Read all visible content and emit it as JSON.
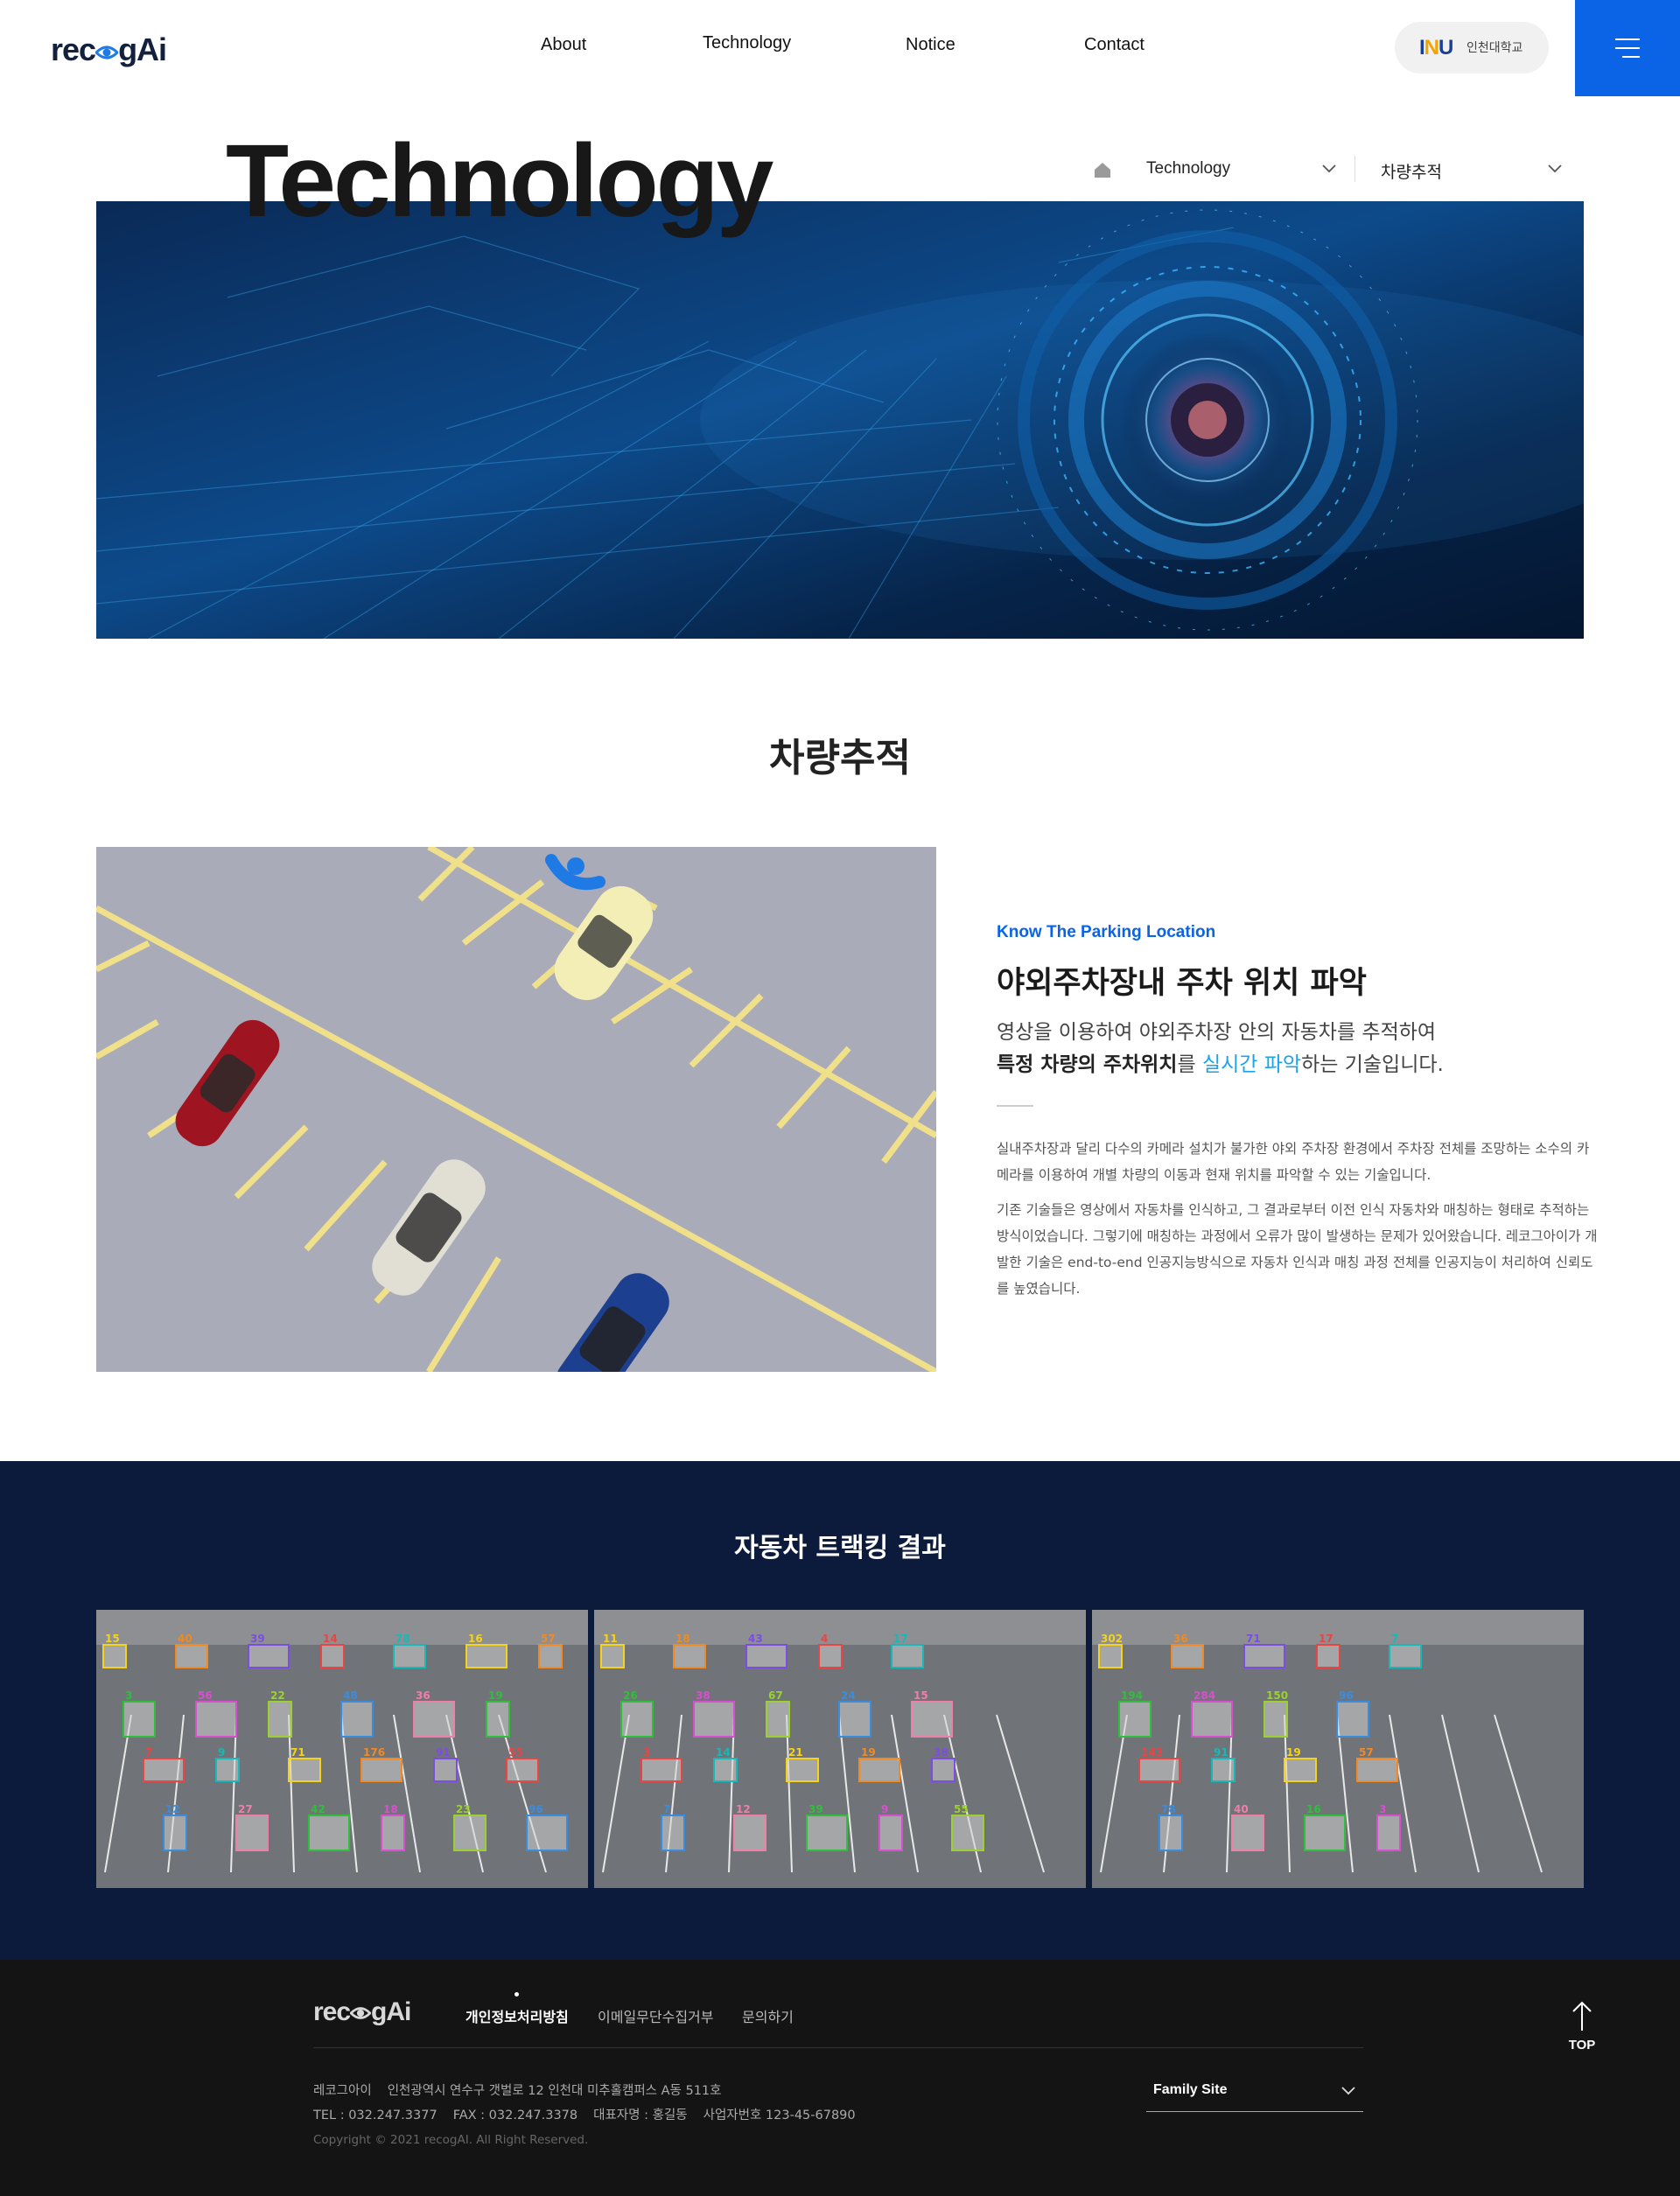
{
  "header": {
    "logo_left": "rec",
    "logo_right": "gAi",
    "nav": [
      {
        "label": "About"
      },
      {
        "label": "Technology"
      },
      {
        "label": "Notice"
      },
      {
        "label": "Contact"
      }
    ],
    "univ_mark_1": "I",
    "univ_mark_2": "N",
    "univ_mark_3": "U",
    "univ_name": "인천대학교",
    "menu_icon": "hamburger-icon",
    "accent": "#0b63e6"
  },
  "hero": {
    "title": "Technology",
    "breadcrumb": {
      "home_icon": "home-icon",
      "level1": "Technology",
      "level2": "차량추적"
    }
  },
  "section": {
    "title": "차량추적",
    "eyebrow": "Know The Parking Location",
    "heading": "야외주차장내 주차 위치 파악",
    "lead_line1": "영상을 이용하여 야외주차장 안의 자동차를 추적하여",
    "lead_bold": "특정 차량의 주차위치",
    "lead_mid": "를 ",
    "lead_highlight": "실시간 파악",
    "lead_end": "하는 기술입니다.",
    "paragraph1": "실내주차장과 달리 다수의 카메라 설치가 불가한 야외 주차장 환경에서 주차장 전체를 조망하는 소수의 카메라를 이용하여 개별 차량의 이동과 현재 위치를 파악할 수 있는 기술입니다.",
    "paragraph2": "기존 기술들은 영상에서 자동차를 인식하고, 그 결과로부터 이전 인식 자동차와 매칭하는 형태로 추적하는 방식이었습니다. 그렇기에 매칭하는 과정에서 오류가 많이 발생하는 문제가 있어왔습니다. 레코그아이가 개발한 기술은 end-to-end 인공지능방식으로 자동차 인식과 매칭 과정 전체를 인공지능이 처리하여 신뢰도를 높였습니다.",
    "highlight_color": "#1aa3e8"
  },
  "results": {
    "title": "자동차 트랙킹 결과",
    "background": "#0c1a3b",
    "frames": [
      {
        "labels": [
          "15",
          "3",
          "7",
          "12",
          "40",
          "56",
          "9",
          "27",
          "39",
          "22",
          "71",
          "42",
          "14",
          "48",
          "176",
          "18",
          "78",
          "36",
          "91",
          "23",
          "16",
          "19",
          "55",
          "96",
          "57"
        ]
      },
      {
        "labels": [
          "11",
          "26",
          "3",
          "7",
          "18",
          "38",
          "14",
          "12",
          "43",
          "67",
          "21",
          "39",
          "4",
          "24",
          "19",
          "9",
          "17",
          "15",
          "38",
          "55"
        ]
      },
      {
        "labels": [
          "302",
          "194",
          "143",
          "78",
          "36",
          "284",
          "91",
          "40",
          "71",
          "150",
          "19",
          "16",
          "17",
          "96",
          "57",
          "3",
          "7"
        ]
      }
    ]
  },
  "footer": {
    "logo_left": "rec",
    "logo_right": "gAi",
    "links": [
      {
        "label": "개인정보처리방침"
      },
      {
        "label": "이메일무단수집거부"
      },
      {
        "label": "문의하기"
      }
    ],
    "address": {
      "company": "레코그아이",
      "addr": "인천광역시 연수구 갯벌로 12 인천대 미추홀캠퍼스 A동 511호",
      "tel": "TEL : 032.247.3377",
      "fax": "FAX : 032.247.3378",
      "ceo": "대표자명 : 홍길동",
      "biz": "사업자번호 123-45-67890"
    },
    "copyright": "Copyright © 2021 recogAI. All Right Reserved.",
    "family_site": "Family Site",
    "top_label": "TOP",
    "background": "#141414"
  }
}
